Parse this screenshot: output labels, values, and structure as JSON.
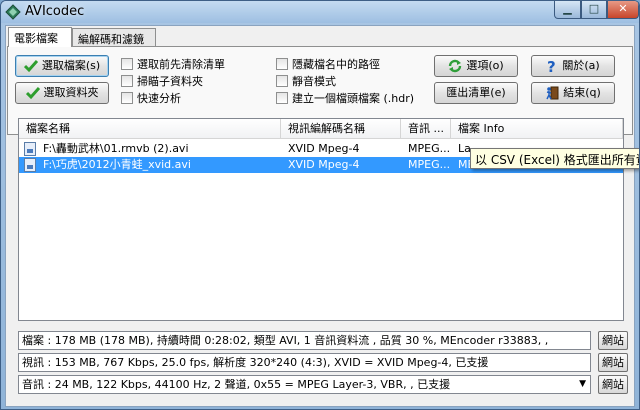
{
  "window": {
    "title": "AVIcodec",
    "minimize_glyph": "▁",
    "maximize_glyph": "□",
    "close_glyph": "✕"
  },
  "tabs": [
    {
      "label": "電影檔案",
      "active": true
    },
    {
      "label": "編解碼和濾鏡",
      "active": false
    }
  ],
  "toolbar": {
    "select_files": "選取檔案(s)",
    "select_folder": "選取資料夾",
    "options": "選項(o)",
    "about": "關於(a)",
    "export_list": "匯出清單(e)",
    "exit": "結束(q)"
  },
  "checkboxes": [
    {
      "label": "選取前先清除清單",
      "checked": false
    },
    {
      "label": "掃瞄子資料夾",
      "checked": false
    },
    {
      "label": "快速分析",
      "checked": false
    },
    {
      "label": "隱藏檔名中的路徑",
      "checked": false
    },
    {
      "label": "靜音模式",
      "checked": false
    },
    {
      "label": "建立一個檔頭檔案 (.hdr)",
      "checked": false
    }
  ],
  "file_list": {
    "columns": [
      "檔案名稱",
      "視訊編解碼名稱",
      "音訊 ...",
      "檔案 Info"
    ],
    "rows": [
      {
        "name": "F:\\轟動武林\\01.rmvb (2).avi",
        "video": "XVID Mpeg-4",
        "audio": "MPEG...",
        "info": "La...",
        "selected": false
      },
      {
        "name": "F:\\巧虎\\2012小青蛙_xvid.avi",
        "video": "XVID Mpeg-4",
        "audio": "MPEG...",
        "info": "MEncoder...",
        "selected": true
      }
    ]
  },
  "tooltip": "以 CSV (Excel) 格式匯出所有資",
  "details": {
    "file": "檔案 : 178 MB (178 MB), 持續時間 0:28:02, 類型 AVI, 1 音訊資料流 , 品質 30 %, MEncoder r33883, ,",
    "video": "視訊 : 153 MB, 767 Kbps, 25.0 fps, 解析度 320*240 (4:3), XVID = XVID Mpeg-4, 已支援",
    "audio": "音訊 : 24 MB, 122 Kbps, 44100 Hz, 2 聲道, 0x55 = MPEG Layer-3, VBR, , 已支援",
    "web_label": "網站"
  },
  "colors": {
    "selection": "#3399ff",
    "tooltip_bg": "#ffffe1",
    "check_green": "#2e9e2e",
    "options_green": "#2f9e3a",
    "about_blue": "#1f5fc0"
  }
}
